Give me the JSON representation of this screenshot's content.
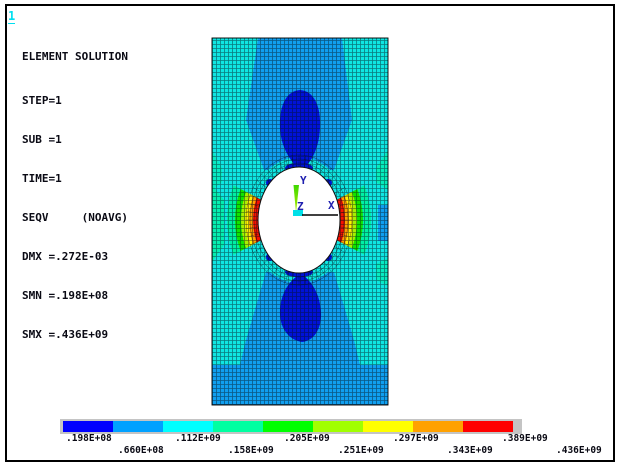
{
  "window": {
    "plot_id": "1"
  },
  "annotation": {
    "lines": [
      "ELEMENT SOLUTION",
      "STEP=1",
      "SUB =1",
      "TIME=1",
      "SEQV     (NOAVG)",
      "DMX =.272E-03",
      "SMN =.198E+08",
      "SMX =.436E+09"
    ]
  },
  "triad": {
    "x_label": "X",
    "y_label": "Y",
    "z_label": "Z"
  },
  "legend": {
    "colors": [
      "#0000ff",
      "#00a1ff",
      "#00ffff",
      "#00ffa1",
      "#00ff00",
      "#a1ff00",
      "#ffff00",
      "#ffa100",
      "#ff0000"
    ],
    "labels_top": [
      ".198E+08",
      ".112E+09",
      ".205E+09",
      ".297E+09",
      ".389E+09"
    ],
    "labels_bottom": [
      ".660E+08",
      ".158E+09",
      ".251E+09",
      ".343E+09",
      ".436E+09"
    ]
  },
  "chart_data": {
    "type": "heatmap",
    "title": "ELEMENT SOLUTION",
    "quantity": "SEQV (NOAVG)",
    "step": "1",
    "sub": "1",
    "time": "1",
    "dmx": ".272E-03",
    "smn": ".198E+08",
    "smx": ".436E+09",
    "contour_bounds": [
      ".198E+08",
      ".660E+08",
      ".112E+09",
      ".158E+09",
      ".205E+09",
      ".251E+09",
      ".297E+09",
      ".343E+09",
      ".389E+09",
      ".436E+09"
    ],
    "palette": [
      "#0000ff",
      "#00a1ff",
      "#00ffff",
      "#00ffa1",
      "#00ff00",
      "#a1ff00",
      "#ffff00",
      "#ffa100",
      "#ff0000"
    ],
    "legend_position": "bottom",
    "subject": "quad-meshed rectangular plate with central circular hole; stress maxima at hole east/west rim, minima in lobes above and below hole"
  }
}
